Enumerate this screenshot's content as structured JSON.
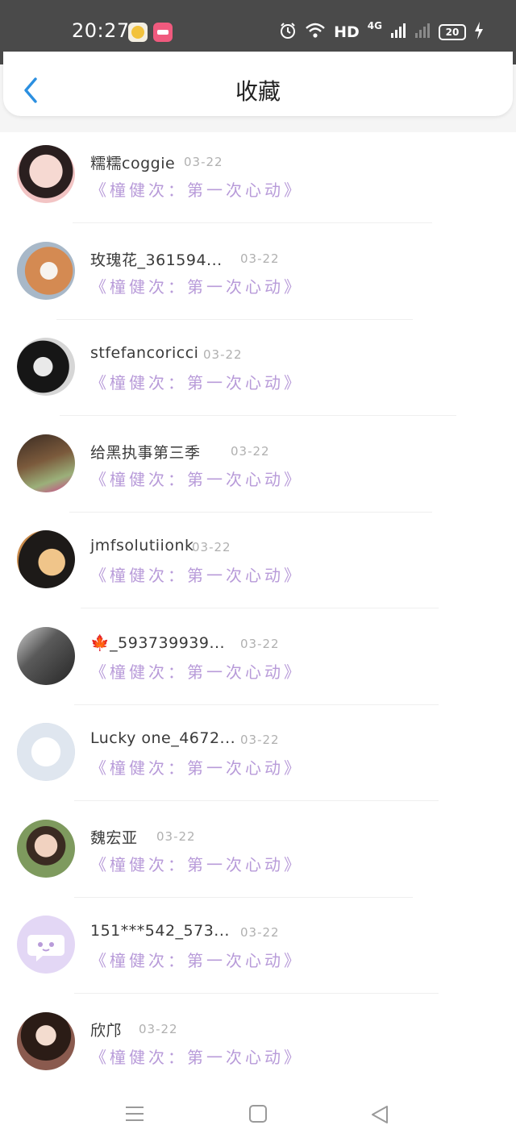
{
  "status_bar": {
    "time": "20:27",
    "network_type": "HD",
    "network_gen": "4G",
    "battery": "20"
  },
  "header": {
    "title": "收藏",
    "back_icon": "chevron-left-icon"
  },
  "items": [
    {
      "name": "糯糯coggie",
      "date": "03-22",
      "work": "《橦健次：第一次心动》",
      "avatar_color": "#e8b4b0"
    },
    {
      "name": "玫瑰花_361594...",
      "date": "03-22",
      "work": "《橦健次：第一次心动》",
      "avatar_color": "#d9a47c"
    },
    {
      "name": "stfefancoricci",
      "date": "03-22",
      "work": "《橦健次：第一次心动》",
      "avatar_color": "#2b2b2b"
    },
    {
      "name": "给黑执事第三季",
      "date": "03-22",
      "work": "《橦健次：第一次心动》",
      "avatar_color": "#6b5a3a"
    },
    {
      "name": "jmfsolutiionk",
      "date": "03-22",
      "work": "《橦健次：第一次心动》",
      "avatar_color": "#2f2a28"
    },
    {
      "name": "🍁_593739939...",
      "date": "03-22",
      "work": "《橦健次：第一次心动》",
      "avatar_color": "#3e3e3e"
    },
    {
      "name": "Lucky one_4672...",
      "date": "03-22",
      "work": "《橦健次：第一次心动》",
      "avatar_color": "#e9edf3"
    },
    {
      "name": "魏宏亚",
      "date": "03-22",
      "work": "《橦健次：第一次心动》",
      "avatar_color": "#8aa06a"
    },
    {
      "name": "151***542_573...",
      "date": "03-22",
      "work": "《橦健次：第一次心动》",
      "avatar_color": "#e3d7f5"
    },
    {
      "name": "欣邝",
      "date": "03-22",
      "work": "《橦健次：第一次心动》",
      "avatar_color": "#5a3a32"
    }
  ],
  "nav": {
    "menu_icon": "menu-icon",
    "home_icon": "square-home-icon",
    "back_icon": "triangle-back-icon"
  }
}
